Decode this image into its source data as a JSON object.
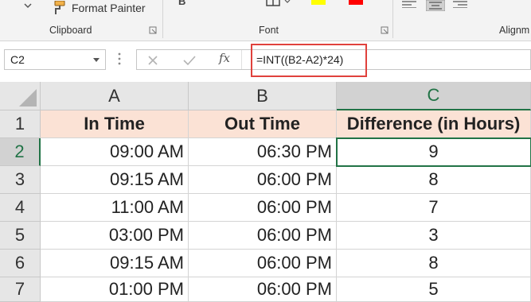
{
  "ribbon": {
    "format_painter_label": "Format Painter",
    "bold_label": "B",
    "groups": {
      "clipboard": "Clipboard",
      "font": "Font",
      "alignment": "Alignm"
    },
    "colors": {
      "highlight": "#ffff00",
      "font_color": "#ff0000"
    },
    "icons": [
      "chevron-down-icon",
      "format-painter-icon",
      "borders-icon",
      "highlight-icon",
      "font-color-icon",
      "align-left-icon",
      "align-center-icon",
      "align-right-icon"
    ]
  },
  "formula_bar": {
    "name_box": "C2",
    "fx_label": "fx",
    "formula": "=INT((B2-A2)*24)"
  },
  "sheet": {
    "columns": [
      "A",
      "B",
      "C"
    ],
    "rows": [
      "1",
      "2",
      "3",
      "4",
      "5",
      "6",
      "7"
    ],
    "header": [
      "In Time",
      "Out Time",
      "Difference (in Hours)"
    ],
    "data": [
      {
        "in": "09:00 AM",
        "out": "06:30 PM",
        "diff": "9"
      },
      {
        "in": "09:15 AM",
        "out": "06:00 PM",
        "diff": "8"
      },
      {
        "in": "11:00 AM",
        "out": "06:00 PM",
        "diff": "7"
      },
      {
        "in": "03:00 PM",
        "out": "06:00 PM",
        "diff": "3"
      },
      {
        "in": "09:15 AM",
        "out": "06:00 PM",
        "diff": "8"
      },
      {
        "in": "01:00 PM",
        "out": "06:00 PM",
        "diff": "5"
      }
    ],
    "active_cell": "C2",
    "accent_color": "#217346",
    "header_fill": "#fbe2d5"
  }
}
